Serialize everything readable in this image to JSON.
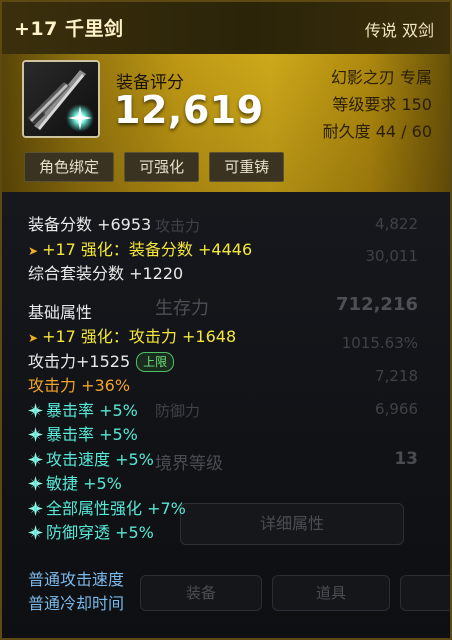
{
  "item": {
    "name": "+17 千里剑",
    "type": "传说 双剑",
    "score_label": "装备评分",
    "score": "12,619",
    "source": "幻影之刃 专属",
    "level_req": "等级要求 150",
    "durability": "耐久度 44 / 60",
    "tags": [
      "角色绑定",
      "可强化",
      "可重铸"
    ]
  },
  "stats": {
    "score_base": "装备分数 +6953",
    "enhance_score": "+17 强化：装备分数 +4446",
    "set_score": "综合套装分数 +1220",
    "section_title": "基础属性",
    "enhance_attack": "+17 强化：攻击力 +1648",
    "attack": "攻击力+1525",
    "attack_badge": "上限",
    "attack_pct": "攻击力 +36%",
    "bonuses": [
      "暴击率 +5%",
      "暴击率 +5%",
      "攻击速度 +5%",
      "敏捷 +5%",
      "全部属性强化 +7%",
      "防御穿透 +5%"
    ],
    "footer": [
      "普通攻击速度",
      "普通冷却时间"
    ]
  },
  "background": {
    "rows": [
      {
        "label": "攻击力",
        "value": "4,822"
      },
      {
        "label": "",
        "value": "30,011"
      },
      {
        "label": "生存力",
        "value": "712,216"
      },
      {
        "label": "",
        "value": "1015.63%"
      },
      {
        "label": "",
        "value": "7,218"
      },
      {
        "label": "防御力",
        "value": "6,966"
      },
      {
        "label": "境界等级",
        "value": "13"
      }
    ],
    "detail_button": "详细属性",
    "tabs": [
      "装备",
      "道具"
    ]
  },
  "colors": {
    "gold": "#caa216",
    "cyan": "#57e8d6",
    "yellow": "#f5e63a",
    "orange": "#f2a42a"
  }
}
